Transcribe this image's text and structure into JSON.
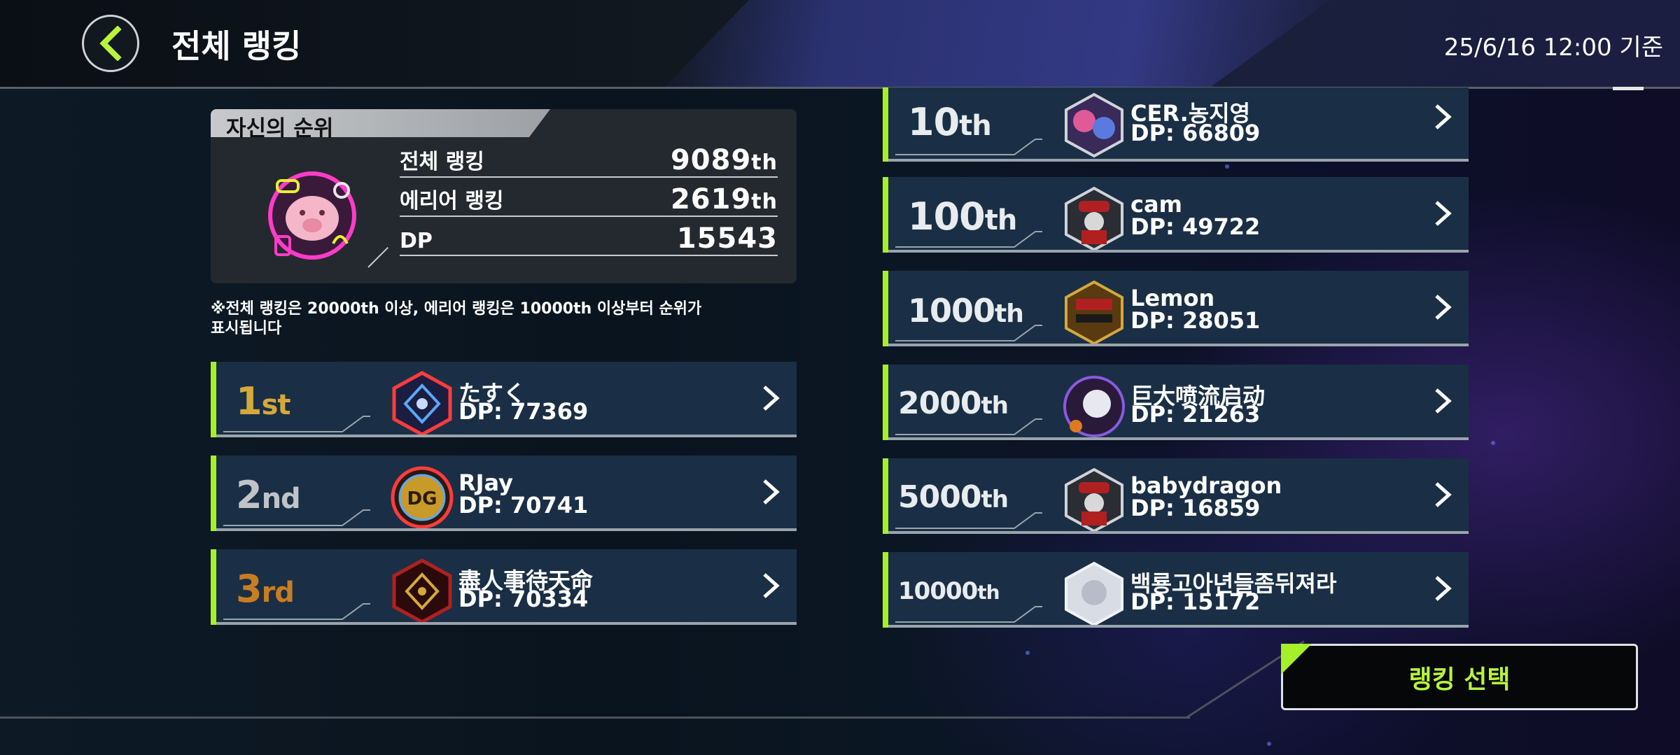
{
  "header": {
    "title": "전체 랭킹",
    "timestamp": "25/6/16 12:00 기준"
  },
  "own_rank": {
    "title": "자신의 순위",
    "rows": [
      {
        "label": "전체 랭킹",
        "value": "9089",
        "suffix": "th"
      },
      {
        "label": "에리어 랭킹",
        "value": "2619",
        "suffix": "th"
      },
      {
        "label": "DP",
        "value": "15543",
        "suffix": ""
      }
    ]
  },
  "notice": {
    "line1": "※전체 랭킹은 20000th 이상, 에리어 랭킹은 10000th 이상부터 순위가",
    "line2": "표시됩니다"
  },
  "top_ranks": [
    {
      "rank": "1",
      "suffix": "st",
      "name": "たすく",
      "dp": "DP: 77369",
      "color": "#d4a93a"
    },
    {
      "rank": "2",
      "suffix": "nd",
      "name": "RJay",
      "dp": "DP: 70741",
      "color": "#c0c4c8"
    },
    {
      "rank": "3",
      "suffix": "rd",
      "name": "盡人事待天命",
      "dp": "DP: 70334",
      "color": "#c97d22"
    }
  ],
  "milestone_ranks": [
    {
      "rank": "10",
      "suffix": "th",
      "name": "CER.농지영",
      "dp": "DP: 66809"
    },
    {
      "rank": "100",
      "suffix": "th",
      "name": "cam",
      "dp": "DP: 49722"
    },
    {
      "rank": "1000",
      "suffix": "th",
      "name": "Lemon",
      "dp": "DP: 28051"
    },
    {
      "rank": "2000",
      "suffix": "th",
      "name": "巨大喷流启动",
      "dp": "DP: 21263"
    },
    {
      "rank": "5000",
      "suffix": "th",
      "name": "babydragon",
      "dp": "DP: 16859"
    },
    {
      "rank": "10000",
      "suffix": "th",
      "name": "백룡고아년들좀뒤져라",
      "dp": "DP: 15172"
    }
  ],
  "footer": {
    "select_button_label": "랭킹 선택"
  },
  "colors": {
    "accent": "#a6f02a",
    "row_bg": "#1a2f45",
    "gold": "#d4a93a",
    "silver": "#c0c4c8",
    "bronze": "#c97d22"
  }
}
